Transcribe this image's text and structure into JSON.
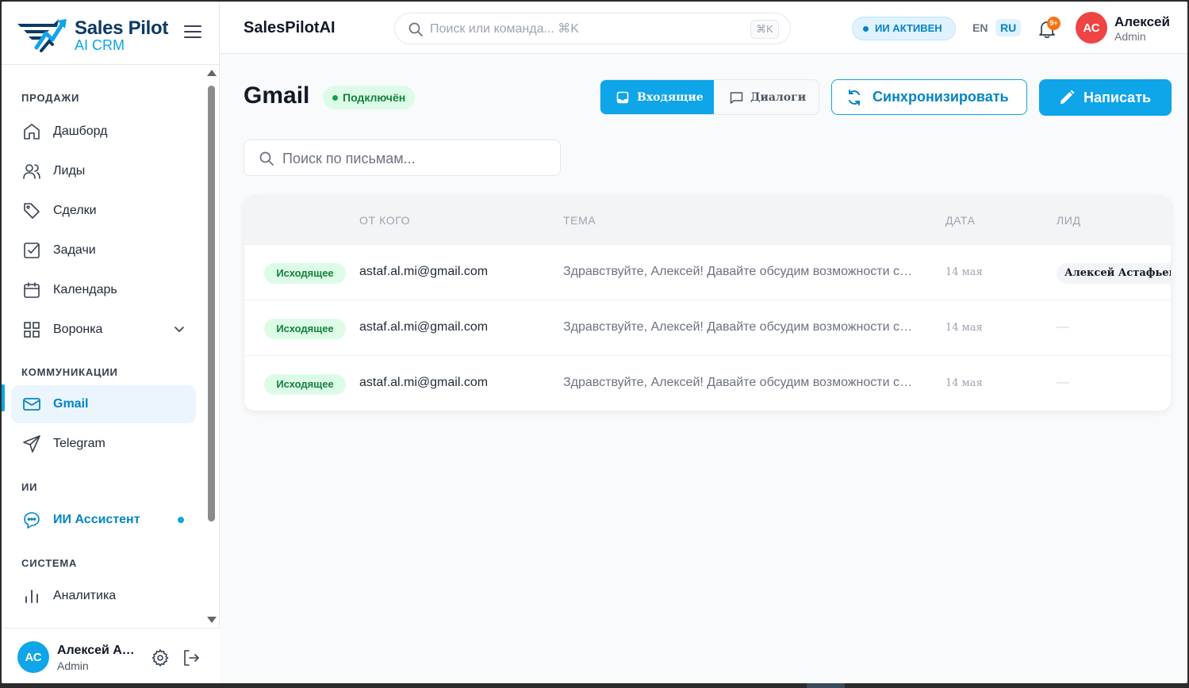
{
  "brand": {
    "name": "Sales Pilot",
    "subtitle": "AI CRM"
  },
  "sidebar": {
    "sections": {
      "sales": "ПРОДАЖИ",
      "communications": "КОММУНИКАЦИИ",
      "ai": "ИИ",
      "system": "СИСТЕМА"
    },
    "items": {
      "dashboard": "Дашборд",
      "leads": "Лиды",
      "deals": "Сделки",
      "tasks": "Задачи",
      "calendar": "Календарь",
      "funnel": "Воронка",
      "gmail": "Gmail",
      "telegram": "Telegram",
      "ai_assistant": "ИИ Ассистент",
      "analytics": "Аналитика"
    },
    "active_item": "gmail",
    "footer": {
      "initials": "АС",
      "name": "Алексей Астафьев",
      "role": "Admin"
    }
  },
  "header": {
    "app_title": "SalesPilotAI",
    "search_placeholder": "Поиск или команда... ⌘K",
    "search_shortcut": "⌘K",
    "ai_status": "ИИ АКТИВЕН",
    "lang_en": "EN",
    "lang_ru": "RU",
    "active_lang": "RU",
    "notifications_badge": "9+",
    "user_initials": "АС",
    "user_name": "Алексей",
    "user_role": "Admin"
  },
  "main": {
    "title": "Gmail",
    "status": "Подключён",
    "tabs": {
      "inbox": "Входящие",
      "dialogs": "Диалоги"
    },
    "active_tab": "inbox",
    "sync_button": "Синхронизировать",
    "compose_button": "Написать",
    "mail_search_placeholder": "Поиск по письмам...",
    "table": {
      "columns": {
        "from": "ОТ КОГО",
        "subject": "ТЕМА",
        "date": "ДАТА",
        "lead": "ЛИД"
      },
      "rows": [
        {
          "direction": "Исходящее",
          "from": "astaf.al.mi@gmail.com",
          "subject": "Здравствуйте, Алексей! Давайте обсудим возможности сотрудничества",
          "date": "14 мая",
          "lead": "Алексей Астафьев"
        },
        {
          "direction": "Исходящее",
          "from": "astaf.al.mi@gmail.com",
          "subject": "Здравствуйте, Алексей! Давайте обсудим возможности сотрудничества",
          "date": "14 мая",
          "lead": "—"
        },
        {
          "direction": "Исходящее",
          "from": "astaf.al.mi@gmail.com",
          "subject": "Здравствуйте, Алексей! Давайте обсудим возможности сотрудничества",
          "date": "14 мая",
          "lead": "—"
        }
      ]
    }
  },
  "colors": {
    "accent": "#0ea5e9",
    "brand_dark": "#0b3a66",
    "success": "#15803d",
    "danger": "#ef4444",
    "badge_orange": "#f97316"
  },
  "icons": {
    "dashboard": "home-icon",
    "leads": "users-icon",
    "deals": "tag-icon",
    "tasks": "checkbox-icon",
    "calendar": "calendar-icon",
    "funnel": "grid-icon",
    "gmail": "mail-icon",
    "telegram": "send-icon",
    "ai_assistant": "chat-bubble-icon",
    "analytics": "bar-chart-icon"
  }
}
